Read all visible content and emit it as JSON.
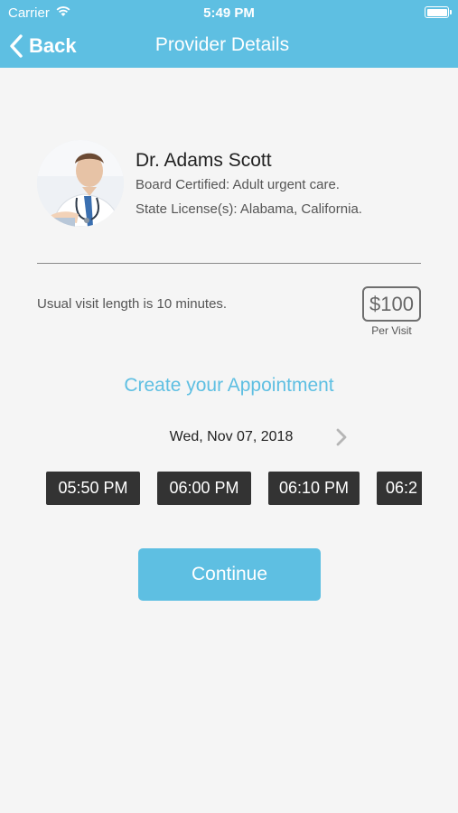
{
  "status": {
    "carrier": "Carrier",
    "time": "5:49 PM"
  },
  "nav": {
    "back_label": "Back",
    "title": "Provider Details"
  },
  "provider": {
    "name": "Dr. Adams Scott",
    "board": "Board Certified: Adult urgent care.",
    "license": "State License(s): Alabama, California."
  },
  "visit": {
    "length_text": "Usual visit length is 10 minutes.",
    "price": "$100",
    "price_unit": "Per Visit"
  },
  "appointment": {
    "heading": "Create your Appointment",
    "date": "Wed, Nov 07, 2018",
    "slots": [
      "05:50 PM",
      "06:00 PM",
      "06:10 PM",
      "06:2"
    ]
  },
  "continue_label": "Continue",
  "colors": {
    "accent": "#5ebfe2",
    "slot_bg": "#333333",
    "background": "#f5f5f5"
  }
}
